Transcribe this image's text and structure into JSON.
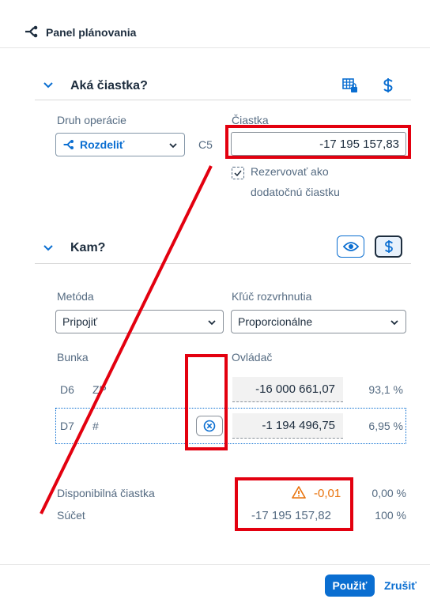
{
  "panel": {
    "title": "Panel plánovania"
  },
  "section_what": {
    "title": "Aká čiastka?",
    "operation_label": "Druh operácie",
    "operation_value": "Rozdeliť",
    "cell_ref": "C5",
    "amount_label": "Čiastka",
    "amount_value": "-17 195 157,83",
    "reserve_label_line1": "Rezervovať ako",
    "reserve_label_line2": "dodatočnú čiastku"
  },
  "section_where": {
    "title": "Kam?",
    "method_label": "Metóda",
    "method_value": "Pripojiť",
    "key_label": "Kľúč rozvrhnutia",
    "key_value": "Proporcionálne",
    "col_cell": "Bunka",
    "col_driver": "Ovládač",
    "rows": [
      {
        "cell": "D6",
        "member": "ZP",
        "value": "-16 000 661,07",
        "pct": "93,1 %"
      },
      {
        "cell": "D7",
        "member": "#",
        "value": "-1 194 496,75",
        "pct": "6,95 %"
      }
    ]
  },
  "summary": {
    "available_label": "Disponibilná čiastka",
    "available_value": "-0,01",
    "available_pct": "0,00 %",
    "sum_label": "Súčet",
    "sum_value": "-17 195 157,82",
    "sum_pct": "100 %"
  },
  "footer": {
    "apply": "Použiť",
    "cancel": "Zrušiť"
  },
  "colors": {
    "accent": "#0a6ed1",
    "warning": "#e9730c",
    "annotation": "#e3000f"
  }
}
